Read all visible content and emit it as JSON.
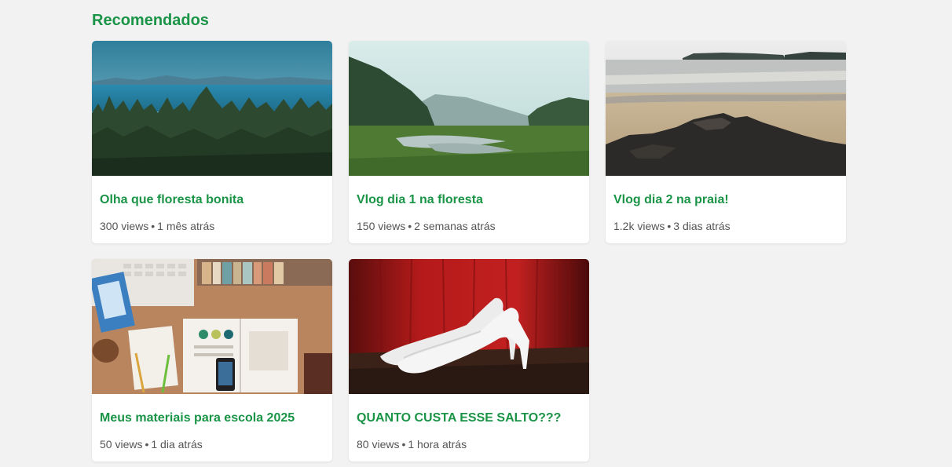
{
  "section": {
    "title": "Recomendados"
  },
  "videos": [
    {
      "title": "Olha que floresta bonita",
      "views": "300 views",
      "sep": "•",
      "age": "1 mês atrás",
      "thumbnail": "forest-lake-scene"
    },
    {
      "title": "Vlog dia 1 na floresta",
      "views": "150 views",
      "sep": "•",
      "age": "2 semanas atrás",
      "thumbnail": "river-valley-scene"
    },
    {
      "title": "Vlog dia 2 na praia!",
      "views": "1.2k views",
      "sep": "•",
      "age": "3 dias atrás",
      "thumbnail": "beach-rocks-scene"
    },
    {
      "title": "Meus materiais para escola 2025",
      "views": "50 views",
      "sep": "•",
      "age": "1 dia atrás",
      "thumbnail": "desk-supplies-scene"
    },
    {
      "title": "QUANTO CUSTA ESSE SALTO???",
      "views": "80 views",
      "sep": "•",
      "age": "1 hora atrás",
      "thumbnail": "white-heels-scene"
    }
  ],
  "colors": {
    "accent": "#1a9446",
    "background": "#f2f2f2",
    "card": "#ffffff",
    "meta_text": "#555555"
  }
}
